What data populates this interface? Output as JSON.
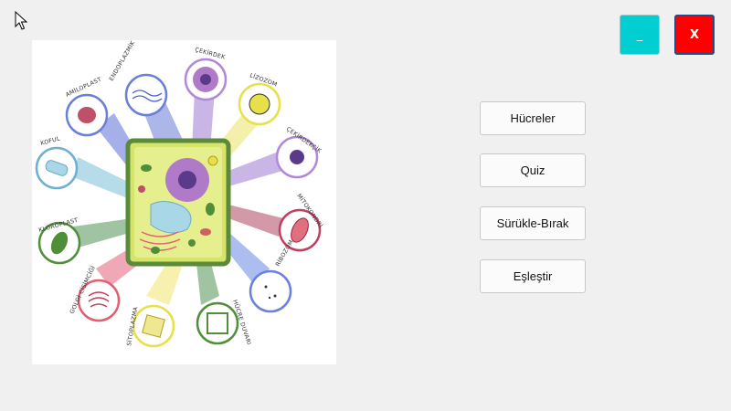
{
  "window": {
    "minimize_label": "_",
    "close_label": "X"
  },
  "menu": {
    "items": [
      "Hücreler",
      "Quiz",
      "Sürükle-Bırak",
      "Eşleştir"
    ]
  },
  "diagram": {
    "labels": {
      "endoplazmik": "ENDOPLAZMİK RETİKULUM",
      "cekirdek": "ÇEKİRDEK",
      "lizozom": "LİZOZOM",
      "cekirdekcik": "ÇEKİRDEKÇİK",
      "mitokondri": "MİTOKONDRİ",
      "ribozom": "RİBOZOM",
      "hucre_duvari": "HÜCRE DUVARI",
      "sitoplazma": "SİTOPLAZMA",
      "golgi": "GOLGİ CİSİMCİĞİ",
      "kloroplast": "KLOROPLAST",
      "koful": "KOFUL",
      "amiloplast": "AMİLOPLAST"
    }
  },
  "colors": {
    "minimize": "#00ced1",
    "close": "#ff0000"
  }
}
